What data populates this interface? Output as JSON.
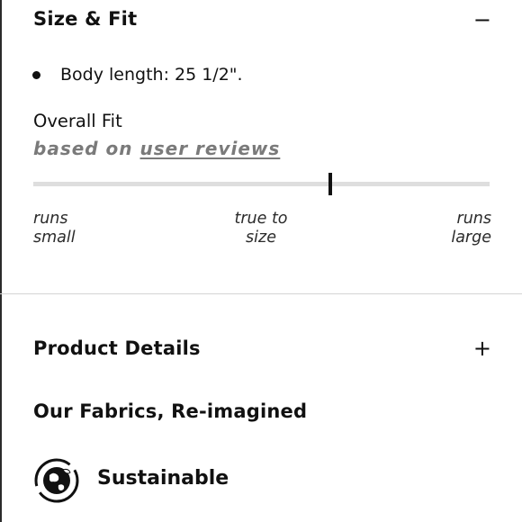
{
  "size_fit": {
    "title": "Size & Fit",
    "toggle": "−",
    "bullet": "Body length: 25 1/2\".",
    "overall_fit_label": "Overall Fit",
    "based_on_prefix": "based on",
    "user_reviews_link": "user reviews",
    "fit_value_fraction": 0.65,
    "scale_labels": {
      "left_line1": "runs",
      "left_line2": "small",
      "center_line1": "true to",
      "center_line2": "size",
      "right_line1": "runs",
      "right_line2": "large"
    }
  },
  "product_details": {
    "title": "Product Details",
    "toggle": "+"
  },
  "fabrics": {
    "title": "Our Fabrics, Re-imagined"
  },
  "sustainable": {
    "label": "Sustainable",
    "icon": "globe-leaf-icon"
  }
}
